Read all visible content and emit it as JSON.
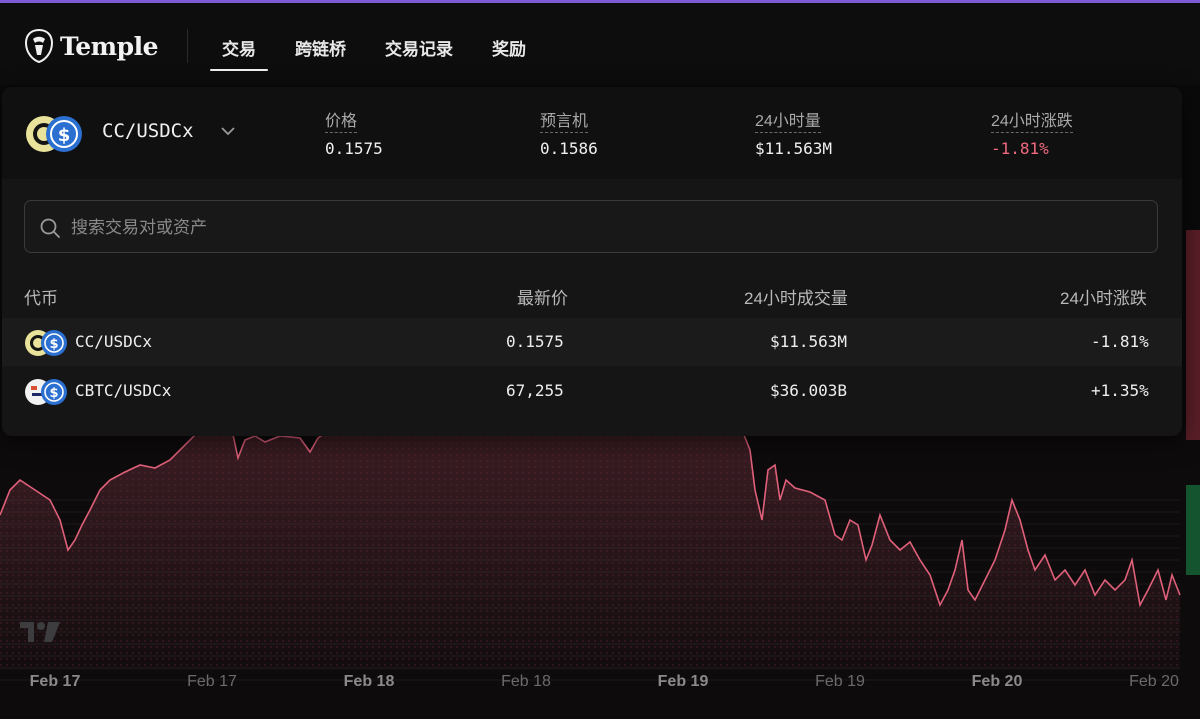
{
  "app": {
    "brand": "Temple"
  },
  "nav": [
    {
      "label": "交易",
      "active": true
    },
    {
      "label": "跨链桥",
      "active": false
    },
    {
      "label": "交易记录",
      "active": false
    },
    {
      "label": "奖励",
      "active": false
    }
  ],
  "market": {
    "pair": "CC/USDCx",
    "stats": [
      {
        "label": "价格",
        "value": "0.1575",
        "tone": "neutral"
      },
      {
        "label": "预言机",
        "value": "0.1586",
        "tone": "neutral"
      },
      {
        "label": "24小时量",
        "value": "$11.563M",
        "tone": "neutral"
      },
      {
        "label": "24小时涨跌",
        "value": "-1.81%",
        "tone": "negative"
      }
    ]
  },
  "search": {
    "placeholder": "搜索交易对或资产"
  },
  "table": {
    "headers": [
      "代币",
      "最新价",
      "24小时成交量",
      "24小时涨跌"
    ],
    "rows": [
      {
        "pair": "CC/USDCx",
        "price": "0.1575",
        "volume": "$11.563M",
        "change": "-1.81%",
        "tone": "negative",
        "icon": "cc-usdc-icon"
      },
      {
        "pair": "CBTC/USDCx",
        "price": "67,255",
        "volume": "$36.003B",
        "change": "+1.35%",
        "tone": "positive",
        "icon": "cbtc-usdc-icon"
      }
    ]
  },
  "chart": {
    "x_ticks": [
      {
        "label": "Feb 17",
        "bold": true
      },
      {
        "label": "Feb 17",
        "bold": false
      },
      {
        "label": "Feb 18",
        "bold": true
      },
      {
        "label": "Feb 18",
        "bold": false
      },
      {
        "label": "Feb 19",
        "bold": true
      },
      {
        "label": "Feb 19",
        "bold": false
      },
      {
        "label": "Feb 20",
        "bold": true
      },
      {
        "label": "Feb 20",
        "bold": false
      }
    ],
    "line_color": "#e0607a"
  },
  "colors": {
    "accent": "#7b5bd6",
    "negative": "#f06a7e",
    "positive": "#3ec28a"
  }
}
